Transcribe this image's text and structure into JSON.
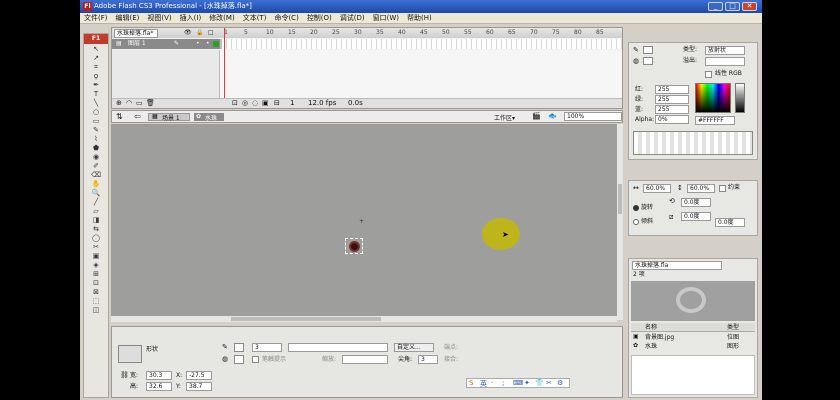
{
  "window": {
    "title": "Adobe Flash CS3 Professional - [水珠掉落.fla*]",
    "app_icon_text": "Fl",
    "min": "_",
    "max": "□",
    "close": "✕"
  },
  "menu": [
    "文件(F)",
    "编辑(E)",
    "视图(V)",
    "插入(I)",
    "修改(M)",
    "文本(T)",
    "命令(C)",
    "控制(O)",
    "调试(D)",
    "窗口(W)",
    "帮助(H)"
  ],
  "toolbox": {
    "header": "F1",
    "tools": [
      "↖",
      "↗",
      "⌗",
      "ϙ",
      "✒",
      "T",
      "╲",
      "○",
      "▭",
      "✎",
      "⌇",
      "⬟",
      "◉",
      "✐",
      "⌫",
      "✋",
      "🔍",
      "╱",
      "▱",
      "◨",
      "⇆",
      "◯",
      "✂",
      "▣",
      "◈",
      "⊞",
      "⊡",
      "⊠",
      "⬚",
      "◫"
    ]
  },
  "timeline": {
    "doc_tab": "水珠掉落.fla*",
    "frame_numbers": [
      "1",
      "5",
      "10",
      "15",
      "20",
      "25",
      "30",
      "35",
      "40",
      "45",
      "50",
      "55",
      "60",
      "65",
      "70",
      "75",
      "80",
      "85"
    ],
    "layer_name": "图层 1",
    "status": {
      "frame": "1",
      "fps": "12.0 fps",
      "time": "0.0s"
    }
  },
  "stagebar": {
    "scene": "场景 1",
    "symbol": "水珠",
    "workspace": "工作区▾",
    "zoom": "100%"
  },
  "props": {
    "type_label": "形状",
    "stroke_value": "3",
    "custom_button": "自定义...",
    "endpoint_label": "端点:",
    "hinting_label": "笔触提示",
    "scale_label": "缩放:",
    "miter_label": "尖角:",
    "miter_value": "3",
    "join_label": "接合:",
    "w_label": "宽:",
    "w_value": "30.3",
    "h_label": "高:",
    "h_value": "32.6",
    "x_label": "X:",
    "x_value": "-27.5",
    "y_label": "Y:",
    "y_value": "38.7"
  },
  "ime_bar": [
    "S",
    "英",
    "·",
    ";",
    "⌨",
    "✦",
    "👕",
    "✂",
    "⚙"
  ],
  "color_panel": {
    "type_label": "类型:",
    "type_value": "放射状",
    "overflow_label": "溢出:",
    "linear_rgb": "线性 RGB",
    "r_label": "红:",
    "r_value": "255",
    "g_label": "绿:",
    "g_value": "255",
    "b_label": "蓝:",
    "b_value": "255",
    "alpha_label": "Alpha:",
    "alpha_value": "0%",
    "hex_value": "#FFFFFF"
  },
  "transform_panel": {
    "scale_w": "60.0%",
    "scale_h": "60.0%",
    "constrain": "约束",
    "rotate_label": "旋转",
    "rotate_value": "0.0度",
    "skew_label": "倾斜",
    "skew1": "0.0度",
    "skew2": "0.0度"
  },
  "library": {
    "doc": "水珠掉落.fla",
    "count": "2 项",
    "col_name": "名称",
    "col_type": "类型",
    "items": [
      {
        "name": "背景图.jpg",
        "type": "位图"
      },
      {
        "name": "水珠",
        "type": "图形"
      }
    ]
  },
  "colors": {
    "title_bar": "#1e4aa8",
    "stage": "#9e9e9c",
    "drop": "#bdb51a",
    "symbol": "#3a1010"
  }
}
